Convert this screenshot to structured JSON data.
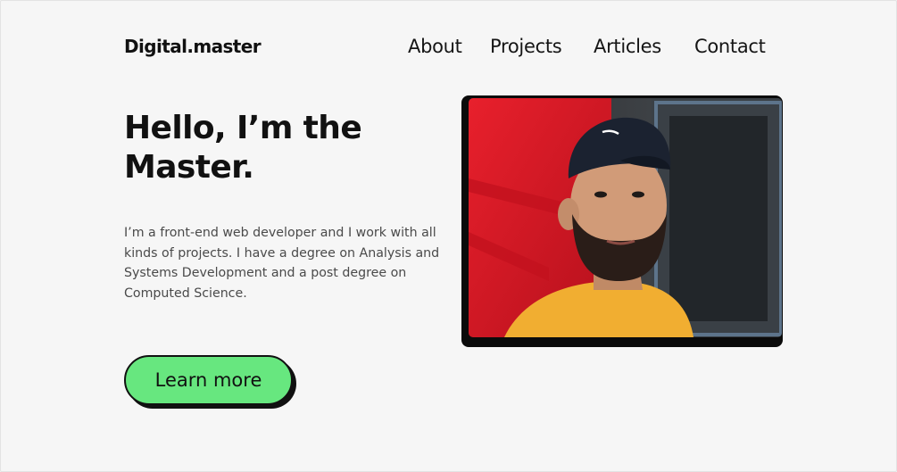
{
  "brand": {
    "logo": "Digital.master"
  },
  "nav": {
    "items": [
      "About",
      "Projects",
      "Articles",
      "Contact"
    ]
  },
  "hero": {
    "title": "Hello, I’m the Master.",
    "description": "I’m a front-end web developer and I work with all kinds of projects. I have a degree on Analysis and Systems Development and a post degree on Computed Science.",
    "cta_label": "Learn more"
  },
  "colors": {
    "background": "#f6f6f6",
    "cta": "#67e77f",
    "text": "#151515"
  },
  "icons": {
    "portrait": "portrait-photo"
  }
}
